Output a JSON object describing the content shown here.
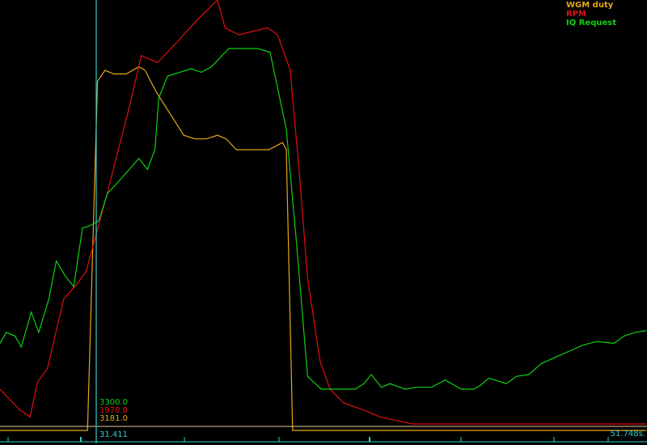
{
  "legend": [
    {
      "name": "WGM duty",
      "color": "#e6a817"
    },
    {
      "name": "RPM",
      "color": "#e01010"
    },
    {
      "name": "IQ Request",
      "color": "#10d010"
    }
  ],
  "cursor": {
    "time": "31.411",
    "values": [
      {
        "text": "3300.0",
        "color": "#10d010"
      },
      {
        "text": "1970.0",
        "color": "#e01010"
      },
      {
        "text": "3181.0",
        "color": "#e6a817"
      }
    ]
  },
  "timeline": {
    "end_label": "51.748s."
  },
  "colors": {
    "background": "#000000",
    "cursor": "#33cccc",
    "axis": "#e6c8a0"
  },
  "chart_data": {
    "type": "line",
    "x_range_s": [
      0,
      51.748
    ],
    "series": [
      {
        "name": "WGM duty",
        "color": "#e6a817",
        "points": [
          [
            0,
            -5
          ],
          [
            7,
            -5
          ],
          [
            7.8,
            95
          ],
          [
            8.4,
            98
          ],
          [
            9.1,
            97
          ],
          [
            10.1,
            97
          ],
          [
            11.1,
            99
          ],
          [
            11.6,
            98
          ],
          [
            12.5,
            92
          ],
          [
            13.6,
            86
          ],
          [
            14.7,
            80
          ],
          [
            15.6,
            79
          ],
          [
            16.5,
            79
          ],
          [
            17.4,
            80
          ],
          [
            18.1,
            79
          ],
          [
            18.9,
            76
          ],
          [
            19.9,
            76
          ],
          [
            21.5,
            76
          ],
          [
            22.6,
            78
          ],
          [
            22.9,
            76
          ],
          [
            23.4,
            -5
          ],
          [
            51.7,
            -5
          ]
        ]
      },
      {
        "name": "RPM",
        "color": "#e01010",
        "points": [
          [
            0,
            50
          ],
          [
            1.6,
            47
          ],
          [
            2.4,
            46
          ],
          [
            3,
            51
          ],
          [
            3.8,
            53
          ],
          [
            5.1,
            63
          ],
          [
            6.1,
            65
          ],
          [
            6.9,
            67
          ],
          [
            7.5,
            71
          ],
          [
            8.4,
            77
          ],
          [
            9.4,
            84
          ],
          [
            10.4,
            91
          ],
          [
            11.3,
            98
          ],
          [
            12.6,
            97
          ],
          [
            14.2,
            100
          ],
          [
            15.7,
            103
          ],
          [
            17.4,
            106
          ],
          [
            18,
            102
          ],
          [
            19.1,
            101
          ],
          [
            21.4,
            102
          ],
          [
            22.2,
            101
          ],
          [
            23.2,
            96
          ],
          [
            23.9,
            82
          ],
          [
            24.6,
            66
          ],
          [
            25.6,
            54
          ],
          [
            26.4,
            50
          ],
          [
            27.5,
            48
          ],
          [
            29.1,
            47
          ],
          [
            30.4,
            46
          ],
          [
            33,
            45
          ],
          [
            35.6,
            45
          ],
          [
            38.1,
            45
          ],
          [
            40.6,
            45
          ],
          [
            43.3,
            45
          ],
          [
            45.4,
            45
          ],
          [
            48,
            45
          ],
          [
            51.7,
            45
          ]
        ]
      },
      {
        "name": "IQ Request",
        "color": "#10d010",
        "points": [
          [
            0,
            4400
          ],
          [
            0.5,
            5000
          ],
          [
            1.2,
            4800
          ],
          [
            1.7,
            4200
          ],
          [
            2.5,
            6100
          ],
          [
            3.1,
            5000
          ],
          [
            3.9,
            6800
          ],
          [
            4.5,
            8900
          ],
          [
            5.2,
            8100
          ],
          [
            5.9,
            7500
          ],
          [
            6.6,
            10700
          ],
          [
            7.1,
            10800
          ],
          [
            7.9,
            11100
          ],
          [
            8.6,
            12600
          ],
          [
            9.3,
            13100
          ],
          [
            10.6,
            14100
          ],
          [
            11.1,
            14500
          ],
          [
            11.8,
            13900
          ],
          [
            12.4,
            15000
          ],
          [
            12.7,
            17800
          ],
          [
            13.4,
            19000
          ],
          [
            15.3,
            19400
          ],
          [
            16.1,
            19200
          ],
          [
            16.9,
            19500
          ],
          [
            17.6,
            20000
          ],
          [
            18.3,
            20500
          ],
          [
            20.6,
            20500
          ],
          [
            21.6,
            20300
          ],
          [
            22.9,
            16100
          ],
          [
            23.7,
            10000
          ],
          [
            24.6,
            2600
          ],
          [
            25.7,
            1900
          ],
          [
            26.8,
            1900
          ],
          [
            28.4,
            1900
          ],
          [
            29.1,
            2200
          ],
          [
            29.7,
            2700
          ],
          [
            30.5,
            2000
          ],
          [
            31.2,
            2200
          ],
          [
            32.4,
            1900
          ],
          [
            33.3,
            2000
          ],
          [
            34.5,
            2000
          ],
          [
            35.6,
            2400
          ],
          [
            36.9,
            1900
          ],
          [
            37.9,
            1900
          ],
          [
            38.4,
            2100
          ],
          [
            39.1,
            2500
          ],
          [
            40.5,
            2200
          ],
          [
            41.3,
            2600
          ],
          [
            42.3,
            2700
          ],
          [
            43.3,
            3300
          ],
          [
            44.6,
            3700
          ],
          [
            45.6,
            4000
          ],
          [
            46.6,
            4300
          ],
          [
            47.7,
            4500
          ],
          [
            49.1,
            4400
          ],
          [
            49.9,
            4800
          ],
          [
            50.8,
            5000
          ],
          [
            51.7,
            5100
          ]
        ]
      }
    ]
  }
}
